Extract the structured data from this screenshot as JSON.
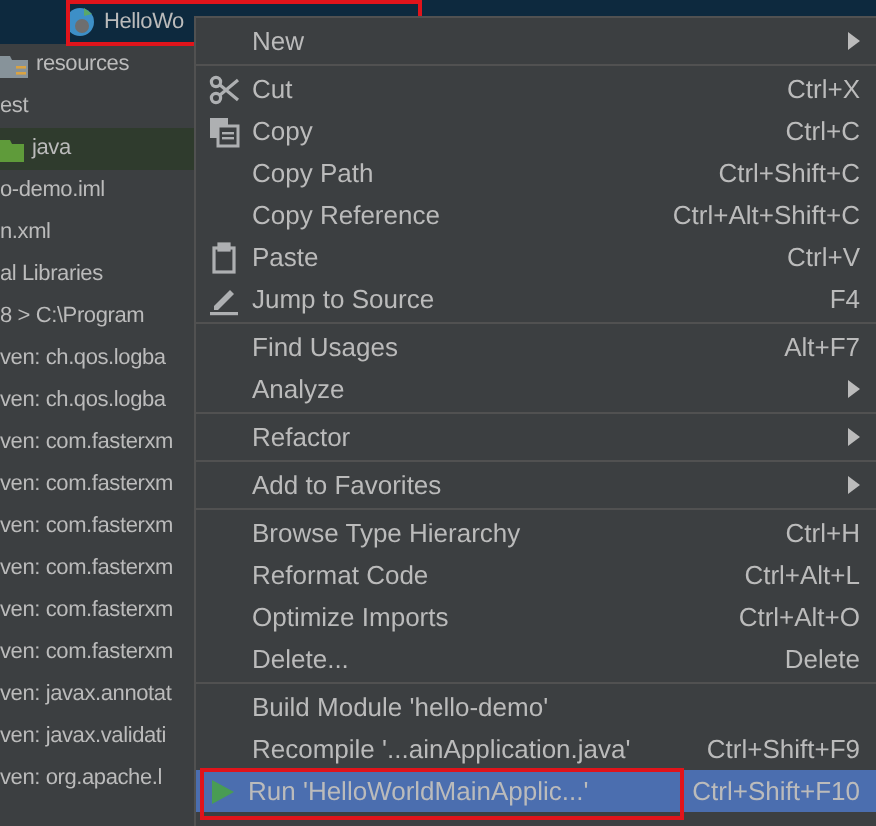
{
  "tree": {
    "items": [
      {
        "label": "HelloWo",
        "selected": true
      },
      {
        "label": "resources",
        "selected": false
      },
      {
        "label": "est",
        "selected": false
      },
      {
        "label": "java",
        "selected": true
      },
      {
        "label": "o-demo.iml",
        "selected": false
      },
      {
        "label": "n.xml",
        "selected": false
      },
      {
        "label": "al Libraries",
        "selected": false
      },
      {
        "label": "8 >  C:\\Program",
        "selected": false
      },
      {
        "label": "ven: ch.qos.logba",
        "selected": false
      },
      {
        "label": "ven: ch.qos.logba",
        "selected": false
      },
      {
        "label": "ven: com.fasterxm",
        "selected": false
      },
      {
        "label": "ven: com.fasterxm",
        "selected": false
      },
      {
        "label": "ven: com.fasterxm",
        "selected": false
      },
      {
        "label": "ven: com.fasterxm",
        "selected": false
      },
      {
        "label": "ven: com.fasterxm",
        "selected": false
      },
      {
        "label": "ven: com.fasterxm",
        "selected": false
      },
      {
        "label": "ven: javax.annotat",
        "selected": false
      },
      {
        "label": "ven: javax.validati",
        "selected": false
      },
      {
        "label": "ven: org.apache.l",
        "selected": false
      }
    ]
  },
  "context_menu": {
    "items": [
      {
        "kind": "submenu",
        "label": "New",
        "selected": false
      },
      {
        "kind": "separator"
      },
      {
        "kind": "item",
        "label": "Cut",
        "shortcut": "Ctrl+X",
        "selected": false
      },
      {
        "kind": "item",
        "label": "Copy",
        "shortcut": "Ctrl+C",
        "selected": false
      },
      {
        "kind": "item",
        "label": "Copy Path",
        "shortcut": "Ctrl+Shift+C",
        "selected": false
      },
      {
        "kind": "item",
        "label": "Copy Reference",
        "shortcut": "Ctrl+Alt+Shift+C",
        "selected": false
      },
      {
        "kind": "item",
        "label": "Paste",
        "shortcut": "Ctrl+V",
        "selected": false
      },
      {
        "kind": "item",
        "label": "Jump to Source",
        "shortcut": "F4",
        "selected": false
      },
      {
        "kind": "separator"
      },
      {
        "kind": "item",
        "label": "Find Usages",
        "shortcut": "Alt+F7",
        "selected": false
      },
      {
        "kind": "submenu",
        "label": "Analyze",
        "selected": false
      },
      {
        "kind": "separator"
      },
      {
        "kind": "submenu",
        "label": "Refactor",
        "selected": false
      },
      {
        "kind": "separator"
      },
      {
        "kind": "submenu",
        "label": "Add to Favorites",
        "selected": false
      },
      {
        "kind": "separator"
      },
      {
        "kind": "item",
        "label": "Browse Type Hierarchy",
        "shortcut": "Ctrl+H",
        "selected": false
      },
      {
        "kind": "item",
        "label": "Reformat Code",
        "shortcut": "Ctrl+Alt+L",
        "selected": false
      },
      {
        "kind": "item",
        "label": "Optimize Imports",
        "shortcut": "Ctrl+Alt+O",
        "selected": false
      },
      {
        "kind": "item",
        "label": "Delete...",
        "shortcut": "Delete",
        "selected": false
      },
      {
        "kind": "separator"
      },
      {
        "kind": "item",
        "label": "Build Module 'hello-demo'",
        "selected": false
      },
      {
        "kind": "item",
        "label": "Recompile '...ainApplication.java'",
        "shortcut": "Ctrl+Shift+F9",
        "selected": false
      },
      {
        "kind": "item",
        "label": "Run 'HelloWorldMainApplic...'",
        "shortcut": "Ctrl+Shift+F10",
        "selected": true
      }
    ]
  }
}
